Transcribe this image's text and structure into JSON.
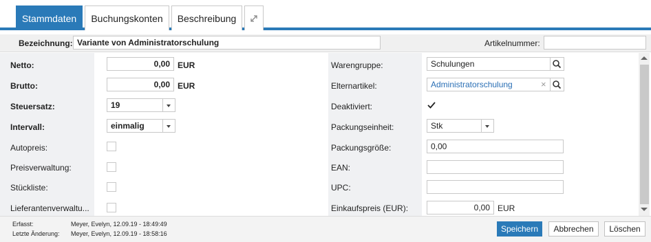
{
  "tabs": [
    {
      "label": "Stammdaten",
      "active": true
    },
    {
      "label": "Buchungskonten",
      "active": false
    },
    {
      "label": "Beschreibung",
      "active": false
    }
  ],
  "header": {
    "bezeichnung_label": "Bezeichnung:",
    "bezeichnung_value": "Variante von Administratorschulung",
    "artikelnummer_label": "Artikelnummer:",
    "artikelnummer_value": ""
  },
  "left": {
    "netto_label": "Netto:",
    "netto_value": "0,00",
    "netto_unit": "EUR",
    "brutto_label": "Brutto:",
    "brutto_value": "0,00",
    "brutto_unit": "EUR",
    "steuersatz_label": "Steuersatz:",
    "steuersatz_value": "19",
    "intervall_label": "Intervall:",
    "intervall_value": "einmalig",
    "autopreis_label": "Autopreis:",
    "preisverwaltung_label": "Preisverwaltung:",
    "stueckliste_label": "Stückliste:",
    "lieferantenverwaltung_label": "Lieferantenverwaltu..."
  },
  "right": {
    "warengruppe_label": "Warengruppe:",
    "warengruppe_value": "Schulungen",
    "elternartikel_label": "Elternartikel:",
    "elternartikel_value": "Administratorschulung",
    "deaktiviert_label": "Deaktiviert:",
    "deaktiviert_checked": true,
    "packungseinheit_label": "Packungseinheit:",
    "packungseinheit_value": "Stk",
    "packungsgroesse_label": "Packungsgröße:",
    "packungsgroesse_value": "0,00",
    "ean_label": "EAN:",
    "ean_value": "",
    "upc_label": "UPC:",
    "upc_value": "",
    "einkaufspreis_label": "Einkaufspreis (EUR):",
    "einkaufspreis_value": "0,00",
    "einkaufspreis_unit": "EUR"
  },
  "footer": {
    "erfasst_label": "Erfasst:",
    "erfasst_value": "Meyer, Evelyn, 12.09.19 - 18:49:49",
    "letzte_aenderung_label": "Letzte Änderung:",
    "letzte_aenderung_value": "Meyer, Evelyn, 12.09.19 - 18:58:16",
    "save_label": "Speichern",
    "cancel_label": "Abbrechen",
    "delete_label": "Löschen"
  },
  "colors": {
    "accent": "#2a7ab8",
    "link": "#2a6fb5"
  },
  "icons": [
    "expand-icon",
    "search-icon",
    "clear-icon",
    "checkmark-icon",
    "chevron-down-icon"
  ]
}
